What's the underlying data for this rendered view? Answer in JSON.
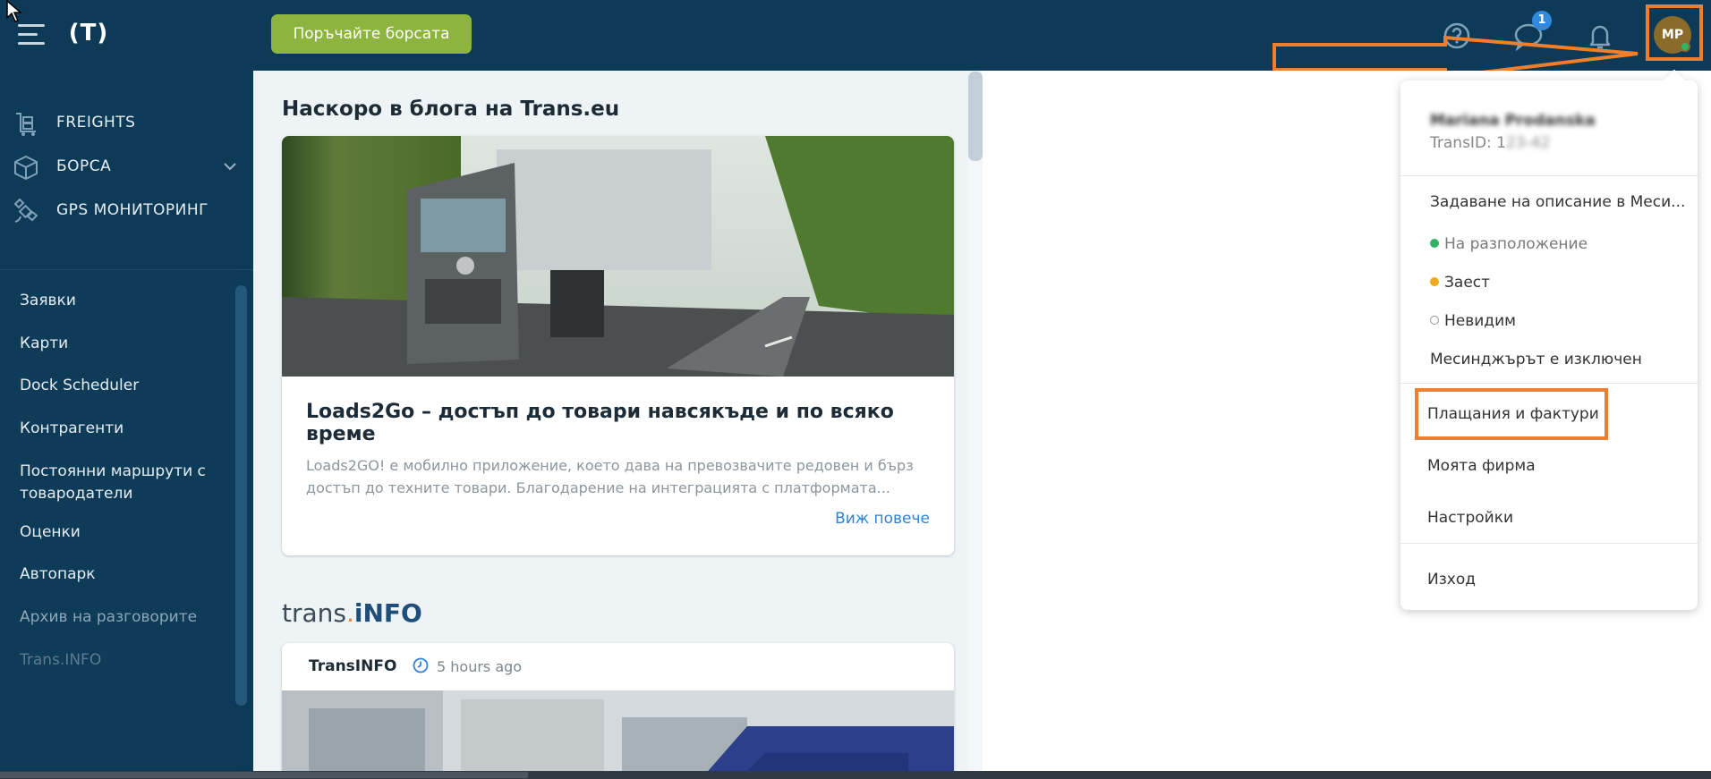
{
  "header": {
    "logo_text": "(T)",
    "order_button_label": "Поръчайте борсата",
    "messages_badge": "1",
    "avatar_initials": "MP"
  },
  "sidebar": {
    "main_items": [
      {
        "label": "FREIGHTS",
        "icon": "freights-icon"
      },
      {
        "label": "БОРСА",
        "icon": "cube-icon"
      },
      {
        "label": "GPS МОНИТОРИНГ",
        "icon": "satellite-icon"
      }
    ],
    "items": [
      {
        "label": "Заявки"
      },
      {
        "label": "Карти"
      },
      {
        "label": "Dock Scheduler"
      },
      {
        "label": "Контрагенти"
      },
      {
        "label": "Постоянни маршрути с товародатели"
      },
      {
        "label": "Оценки"
      },
      {
        "label": "Автопарк"
      },
      {
        "label": "Архив на разговорите"
      },
      {
        "label": "Trans.INFO"
      }
    ]
  },
  "main": {
    "blog_title": "Наскоро в блога на Trans.eu",
    "blog_card": {
      "title": "Loads2Go – достъп до товари навсякъде и по всяко време",
      "text": "Loads2GO! е мобилно приложение, което дава на превозвачите редовен и бърз достъп до техните товари. Благодарение на интеграцията с платформата...",
      "more_link": "Виж повече"
    },
    "transinfo_logo": {
      "part1": "trans",
      "dot": ".",
      "part2": "iNFO"
    },
    "news_card": {
      "source": "TransINFO",
      "time": "5 hours ago"
    }
  },
  "user_menu": {
    "name": "Mariana Prodanska",
    "transid_label": "TransID: 1",
    "transid_hidden": "23-42",
    "items": [
      {
        "label": "Задаване на описание в Меси..."
      },
      {
        "label": "На разположение",
        "status_color": "#2eb35f"
      },
      {
        "label": "Заест",
        "status_color": "#f0a91c"
      },
      {
        "label": "Невидим",
        "status_color": "none"
      },
      {
        "label": "Месинджърът е изключен"
      },
      {
        "label": "Плащания и фактури"
      },
      {
        "label": "Моята фирма"
      },
      {
        "label": "Настройки"
      },
      {
        "label": "Изход"
      }
    ]
  },
  "colors": {
    "topbar": "#0d3a57",
    "accent_green": "#8db43f",
    "highlight_orange": "#ef7f2c",
    "link_blue": "#2f82d6"
  }
}
